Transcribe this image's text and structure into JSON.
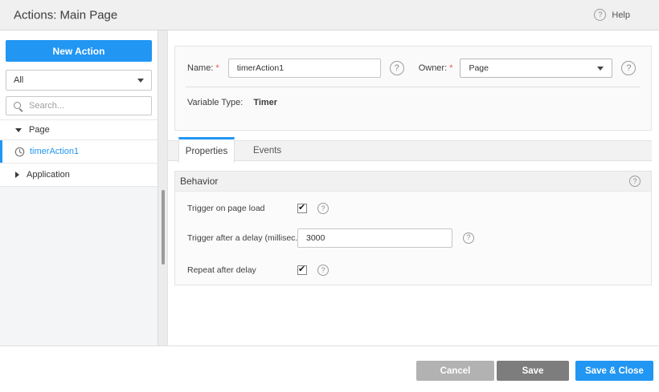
{
  "header": {
    "title": "Actions: Main Page",
    "help_label": "Help"
  },
  "sidebar": {
    "new_action_label": "New Action",
    "filter": {
      "value": "All"
    },
    "search": {
      "placeholder": "Search..."
    },
    "tree": [
      {
        "label": "Page",
        "type": "group",
        "state": "expanded"
      },
      {
        "label": "timerAction1",
        "type": "timer-action",
        "selected": true
      },
      {
        "label": "Application",
        "type": "group",
        "state": "collapsed"
      }
    ]
  },
  "form": {
    "name": {
      "label": "Name:",
      "required": "*",
      "value": "timerAction1"
    },
    "owner": {
      "label": "Owner:",
      "required": "*",
      "value": "Page"
    },
    "variable_type": {
      "label": "Variable Type:",
      "value": "Timer"
    }
  },
  "tabs": [
    {
      "label": "Properties",
      "active": true
    },
    {
      "label": "Events",
      "active": false
    }
  ],
  "behavior": {
    "title": "Behavior",
    "rows": [
      {
        "label": "Trigger on page load",
        "control": "checkbox",
        "checked": true
      },
      {
        "label": "Trigger after a delay (millisec...",
        "control": "input",
        "value": "3000"
      },
      {
        "label": "Repeat after delay",
        "control": "checkbox",
        "checked": true
      }
    ]
  },
  "footer": {
    "buttons": [
      {
        "label": "Cancel"
      },
      {
        "label": "Save"
      },
      {
        "label": "Save & Close",
        "primary": true
      }
    ]
  },
  "colors": {
    "accent": "#2196f3",
    "header_bg": "#f0f0f0",
    "cancel_button": "#b2b2b2",
    "save_button": "#7d7d7d",
    "save_close_button": "#2196f3",
    "selected_tree_text": "#2196f3",
    "required_asterisk": "#ef5350"
  }
}
